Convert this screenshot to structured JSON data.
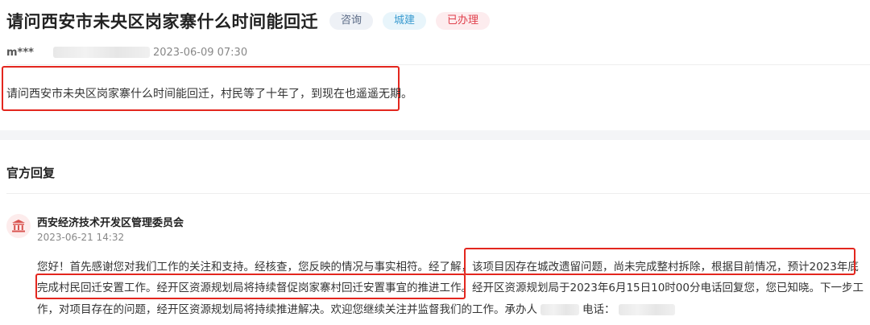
{
  "header": {
    "title": "请问西安市未央区岗家寨什么时间能回迁",
    "tags": [
      {
        "label": "咨询",
        "color": "#5b6b86"
      },
      {
        "label": "城建",
        "color": "#3a9bd0"
      },
      {
        "label": "已办理",
        "color": "#e0404c"
      }
    ]
  },
  "meta": {
    "user": "m***",
    "date": "2023-06-09 07:30"
  },
  "question": {
    "text": "请问西安市未央区岗家寨什么时间能回迁，村民等了十年了，到现在也遥遥无期。"
  },
  "reply": {
    "section_title": "官方回复",
    "org_name": "西安经济技术开发区管理委员会",
    "date": "2023-06-21 14:32",
    "line1_a": "您好！首先感谢您对我们工作的关注和支持。经核查，您反映的情况与事实相符。经了解，",
    "line1_b": "该项目因存在城改遗留问题，尚未完成整村拆除，根据目前情况，预计2023年底",
    "line2_a": "完成村民回迁安置工作。经开区资源规划局将持续督促岗家寨村回迁安置事宜的推进工作。",
    "line2_b": "经开区资源规划局于2023年6月15日10时00分电话回复您，您已知晓。下一步工",
    "line3_a": "作，对项目存在的问题，经开区资源规划局将持续推进解决。欢迎您继续关注并监督我们的工作。承办人",
    "line3_b": "电话："
  },
  "colors": {
    "highlight": "#e3261e",
    "icon": "#d9534f"
  }
}
